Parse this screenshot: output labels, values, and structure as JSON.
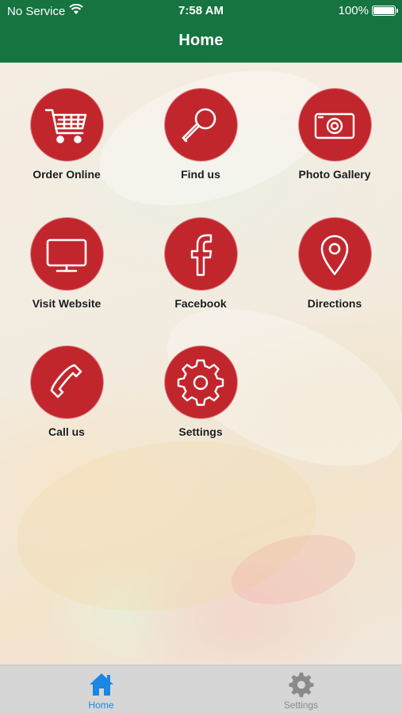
{
  "status_bar": {
    "carrier": "No Service",
    "time": "7:58 AM",
    "battery": "100%"
  },
  "nav": {
    "title": "Home"
  },
  "tiles": [
    {
      "label": "Order Online",
      "icon": "shopping-cart-icon"
    },
    {
      "label": "Find us",
      "icon": "magnifier-icon"
    },
    {
      "label": "Photo Gallery",
      "icon": "camera-icon"
    },
    {
      "label": "Visit Website",
      "icon": "monitor-icon"
    },
    {
      "label": "Facebook",
      "icon": "facebook-icon"
    },
    {
      "label": "Directions",
      "icon": "map-pin-icon"
    },
    {
      "label": "Call us",
      "icon": "phone-icon"
    },
    {
      "label": "Settings",
      "icon": "gear-icon"
    }
  ],
  "tab_bar": {
    "items": [
      {
        "label": "Home",
        "icon": "home-icon",
        "active": true
      },
      {
        "label": "Settings",
        "icon": "gear-icon",
        "active": false
      }
    ]
  },
  "colors": {
    "header": "#157440",
    "tile": "#c2262d",
    "tab_active": "#1a86e5",
    "tab_inactive": "#8a8a8a"
  }
}
